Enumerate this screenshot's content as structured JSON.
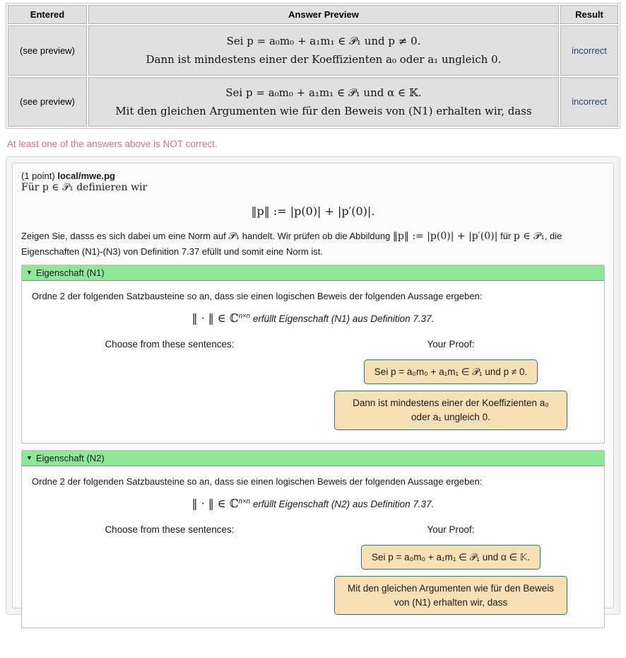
{
  "results_table": {
    "columns": [
      "Entered",
      "Answer Preview",
      "Result"
    ],
    "rows": [
      {
        "entered": "(see preview)",
        "preview_lines": [
          "Sei p = a₀m₀ + a₁m₁ ∈ 𝒫₁ und p ≠ 0.",
          "Dann ist mindestens einer der Koeffizienten a₀ oder a₁ ungleich 0."
        ],
        "result": "incorrect"
      },
      {
        "entered": "(see preview)",
        "preview_lines": [
          "Sei p = a₀m₀ + a₁m₁ ∈ 𝒫₁ und α ∈ 𝕂.",
          "Mit den gleichen Argumenten wie für den Beweis von (N1) erhalten wir, dass"
        ],
        "result": "incorrect"
      }
    ]
  },
  "error_message": "At least one of the answers above is NOT correct.",
  "problem": {
    "points_label": "(1 point)",
    "file_bold": "local",
    "file_rest": "/mwe.pg",
    "intro_line": "Für p ∈ 𝒫₁ definieren wir",
    "display_equation": "‖p‖ := |p(0)| + |p′(0)|.",
    "task_text_1": "Zeigen Sie, dasss es sich dabei um eine Norm auf ",
    "task_math_1": "𝒫₁",
    "task_text_2": " handelt. Wir prüfen ob die Abbildung ",
    "task_math_2": "‖p‖ := |p(0)| + |p′(0)|",
    "task_text_3": " für ",
    "task_math_3": "p ∈ 𝒫₁",
    "task_text_4": ", die Eigenschaften (N1)-(N3) von Definition 7.37 efüllt und somit eine Norm ist."
  },
  "sections": [
    {
      "title": "Eigenschaft (N1)",
      "caret": "▼",
      "instruction": "Ordne 2 der folgenden Satzbausteine so an, dass sie einen logischen Beweis der folgenden Aussage ergeben:",
      "claim_norm": "‖ · ‖ ∈ ℂ",
      "claim_exp": "n×n",
      "claim_rest": " erfüllt Eigenschaft (N1) aus Definition 7.37.",
      "choose_label": "Choose from these sentences:",
      "proof_label": "Your Proof:",
      "choices": [],
      "proof_tiles": [
        "Sei p = a₀m₀ + a₁m₁ ∈ 𝒫₁ und p ≠ 0.",
        "Dann ist mindestens einer der Koeffizienten a₀ oder a₁ ungleich 0."
      ]
    },
    {
      "title": "Eigenschaft (N2)",
      "caret": "▼",
      "instruction": "Ordne 2 der folgenden Satzbausteine so an, dass sie einen logischen Beweis der folgenden Aussage ergeben:",
      "claim_norm": "‖ · ‖ ∈ ℂ",
      "claim_exp": "n×n",
      "claim_rest": " erfüllt Eigenschaft (N2) aus Definition 7.37.",
      "choose_label": "Choose from these sentences:",
      "proof_label": "Your Proof:",
      "choices": [],
      "proof_tiles": [
        "Sei p = a₀m₀ + a₁m₁ ∈ 𝒫₁ und α ∈ 𝕂.",
        "Mit den gleichen Argumenten wie für den Beweis von (N1) erhalten wir, dass"
      ]
    }
  ],
  "colors": {
    "result_incorrect_bg": "#d19393",
    "result_incorrect_text": "#2e3f72",
    "section_header_green": "#8fe89a",
    "tile_bg": "#f7e0b5",
    "tile_border": "#2e7d74",
    "error_text": "#d3737c"
  }
}
